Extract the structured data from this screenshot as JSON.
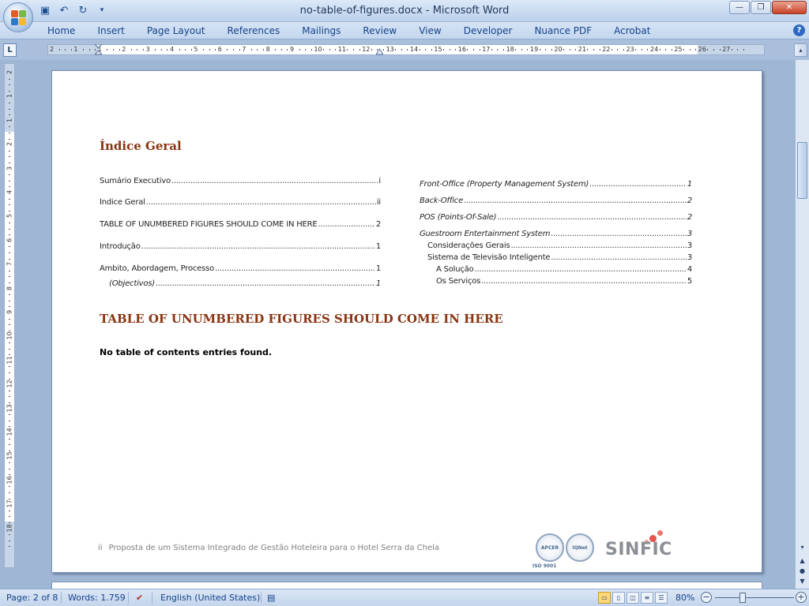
{
  "window": {
    "title": "no-table-of-figures.docx - Microsoft Word",
    "minimize": "—",
    "maximize": "❐",
    "close": "✕"
  },
  "ribbon": {
    "tabs": [
      "Home",
      "Insert",
      "Page Layout",
      "References",
      "Mailings",
      "Review",
      "View",
      "Developer",
      "Nuance PDF",
      "Acrobat"
    ],
    "help": "?"
  },
  "ruler": {
    "corner": "L",
    "ticks": [
      "2",
      "1",
      "1",
      "2",
      "3",
      "4",
      "5",
      "6",
      "7",
      "8",
      "9",
      "10",
      "11",
      "12",
      "13",
      "14",
      "15",
      "16",
      "17",
      "18",
      "19",
      "20",
      "21",
      "22",
      "23",
      "24",
      "25",
      "26",
      "27"
    ],
    "vticks": [
      "2",
      "1",
      "1",
      "2",
      "3",
      "4",
      "5",
      "6",
      "7",
      "8",
      "9",
      "10",
      "11",
      "12",
      "13",
      "14",
      "15",
      "16",
      "17",
      "18"
    ]
  },
  "document": {
    "indice_heading": "Índice Geral",
    "toc_left": [
      {
        "label": "Sumário Executivo",
        "page": "i"
      },
      {
        "label": "Índice Geral",
        "page": "ii"
      },
      {
        "label": "TABLE OF UNUMBERED FIGURES SHOULD COME IN HERE ",
        "page": "2"
      },
      {
        "label": "Introdução",
        "page": "1"
      },
      {
        "label": "Âmbito, Abordagem, Processo",
        "page": "1"
      },
      {
        "label": "(Objectivos)",
        "page": "1"
      }
    ],
    "toc_right": [
      {
        "label": "Front-Office (Property Management System)",
        "page": "1"
      },
      {
        "label": "Back-Office",
        "page": "2"
      },
      {
        "label": "POS (Points-Of-Sale)",
        "page": "2"
      },
      {
        "label": "Guestroom Entertainment System",
        "page": "3"
      },
      {
        "label": "Considerações Gerais",
        "page": "3"
      },
      {
        "label": "Sistema de Televisão Inteligente",
        "page": "3"
      },
      {
        "label": "A Solução",
        "page": "4"
      },
      {
        "label": "Os Serviços",
        "page": "5"
      }
    ],
    "figures_heading": "TABLE OF UNUMBERED FIGURES SHOULD COME IN HERE",
    "no_entries": "No table of contents entries found.",
    "footer_page": "ii",
    "footer_text": "Proposta de um Sistema Integrado de Gestão Hoteleira para o Hotel Serra da Chela",
    "logo_apcer": "APCER",
    "logo_iso": "ISO 9001",
    "logo_iqnet": "IQNet",
    "logo_sinfic": "SINFIC"
  },
  "statusbar": {
    "page": "Page: 2 of 8",
    "words": "Words: 1.759",
    "language": "English (United States)",
    "zoom": "80%",
    "zoom_minus": "−",
    "zoom_plus": "+"
  },
  "colors": {
    "heading": "#8a3412",
    "ribbon_text": "#15428b",
    "sinfic_dot": "#e8554a"
  }
}
